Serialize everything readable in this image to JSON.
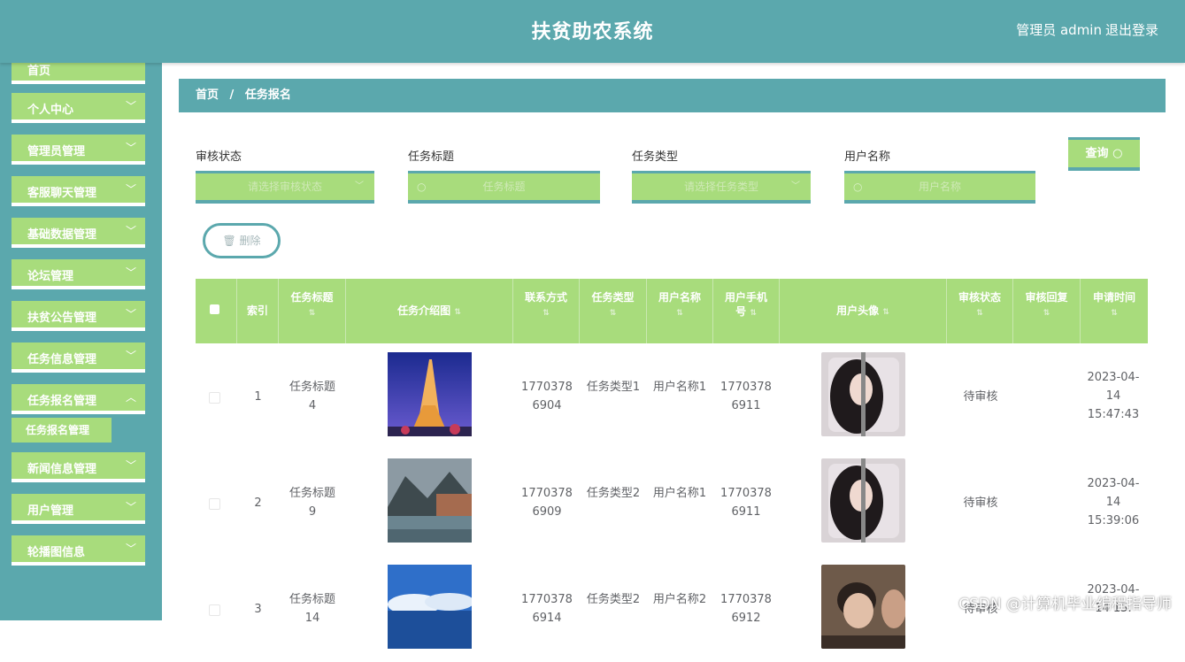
{
  "header": {
    "title": "扶贫助农系统",
    "user_label": "管理员 admin",
    "logout_label": "退出登录"
  },
  "sidebar": {
    "items": [
      {
        "label": "首页"
      },
      {
        "label": "个人中心"
      },
      {
        "label": "管理员管理"
      },
      {
        "label": "客服聊天管理"
      },
      {
        "label": "基础数据管理"
      },
      {
        "label": "论坛管理"
      },
      {
        "label": "扶贫公告管理"
      },
      {
        "label": "任务信息管理"
      },
      {
        "label": "任务报名管理"
      },
      {
        "label": "新闻信息管理"
      },
      {
        "label": "用户管理"
      },
      {
        "label": "轮播图信息"
      }
    ],
    "sub_item": "任务报名管理"
  },
  "breadcrumb": {
    "home": "首页",
    "separator": "/",
    "current": "任务报名"
  },
  "filters": {
    "status_label": "审核状态",
    "status_placeholder": "请选择审核状态",
    "title_label": "任务标题",
    "title_placeholder": "任务标题",
    "type_label": "任务类型",
    "type_placeholder": "请选择任务类型",
    "user_label": "用户名称",
    "user_placeholder": "用户名称",
    "query_label": "查询"
  },
  "actions": {
    "delete_label": "删除"
  },
  "table": {
    "headers": {
      "index": "索引",
      "title": "任务标题",
      "image": "任务介绍图",
      "contact": "联系方式",
      "type": "任务类型",
      "username": "用户名称",
      "phone": "用户手机号",
      "avatar": "用户头像",
      "status": "审核状态",
      "reply": "审核回复",
      "time": "申请时间"
    },
    "rows": [
      {
        "index": "1",
        "title": "任务标题4",
        "contact": "17703786904",
        "type": "任务类型1",
        "username": "用户名称1",
        "phone": "17703786911",
        "status": "待审核",
        "time": "2023-04-14 15:47:43"
      },
      {
        "index": "2",
        "title": "任务标题9",
        "contact": "17703786909",
        "type": "任务类型2",
        "username": "用户名称1",
        "phone": "17703786911",
        "status": "待审核",
        "time": "2023-04-14 15:39:06"
      },
      {
        "index": "3",
        "title": "任务标题14",
        "contact": "17703786914",
        "type": "任务类型2",
        "username": "用户名称2",
        "phone": "17703786912",
        "status": "待审核",
        "time": "2023-04-14 15:"
      }
    ]
  },
  "watermark": "CSDN @计算机毕业编程指导师",
  "colors": {
    "primary": "#5ba8ad",
    "accent": "#a8dc7c"
  }
}
